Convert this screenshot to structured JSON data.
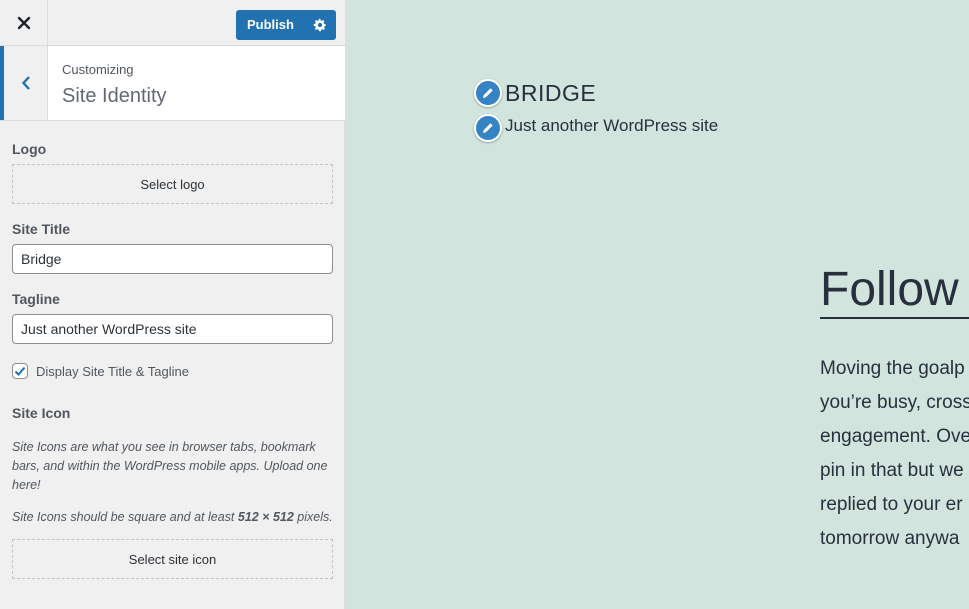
{
  "topbar": {
    "close_icon": "close-icon",
    "publish_label": "Publish",
    "settings_icon": "gear-icon",
    "accent_color": "#2271b1"
  },
  "section": {
    "crumb": "Customizing",
    "title": "Site Identity",
    "back_icon": "chevron-left-icon"
  },
  "form": {
    "logo_label": "Logo",
    "select_logo": "Select logo",
    "site_title_label": "Site Title",
    "site_title_value": "Bridge",
    "tagline_label": "Tagline",
    "tagline_value": "Just another WordPress site",
    "display_checkbox_label": "Display Site Title & Tagline",
    "display_checked": true,
    "site_icon_label": "Site Icon",
    "site_icon_desc": "Site Icons are what you see in browser tabs, bookmark bars, and within the WordPress mobile apps. Upload one here!",
    "site_icon_size_prefix": "Site Icons should be square and at least ",
    "site_icon_size_bold": "512 × 512",
    "site_icon_size_suffix": " pixels.",
    "select_site_icon": "Select site icon"
  },
  "preview": {
    "site_title": "BRIDGE",
    "tagline": "Just another WordPress site",
    "heading": "Follow",
    "paragraph_lines": [
      "Moving the goalp",
      "you’re busy, cross",
      "engagement. Ove",
      "pin in that but we",
      "replied to your er",
      "tomorrow anywa"
    ],
    "background_color": "#d1e4dd"
  }
}
